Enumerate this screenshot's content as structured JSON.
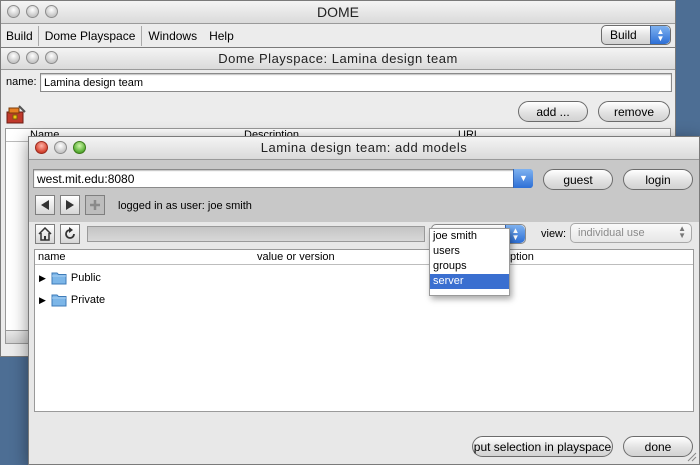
{
  "dome_window": {
    "title": "DOME"
  },
  "menubar": {
    "items": [
      "Build",
      "Dome Playspace",
      "Windows",
      "Help"
    ],
    "mode_select": "Build"
  },
  "playspace_window": {
    "title": "Dome Playspace: Lamina design team",
    "name_label": "name:",
    "name_value": "Lamina design team",
    "add_label": "add ...",
    "remove_label": "remove",
    "columns": [
      "Name",
      "Description",
      "URL"
    ]
  },
  "add_models_window": {
    "title": "Lamina design team: add models",
    "server_value": "west.mit.edu:8080",
    "guest_label": "guest",
    "login_label": "login",
    "status_text": "logged in as user: joe smith",
    "view_label": "view:",
    "view_value": "individual use",
    "columns": [
      "name",
      "value or version",
      "ption"
    ],
    "folders": [
      "Public",
      "Private"
    ],
    "dropdown": {
      "options": [
        "joe smith",
        "users",
        "groups",
        "server"
      ],
      "highlighted": "server"
    },
    "put_selection_label": "put selection in playspace",
    "done_label": "done"
  },
  "colors": {
    "desktop": "#4d6e94",
    "highlight": "#3a6fd0",
    "folder": "#7cb6e8"
  },
  "icons": [
    "tools-icon",
    "back-arrow-icon",
    "forward-arrow-icon",
    "plus-icon",
    "home-icon",
    "refresh-icon",
    "folder-icon",
    "disclosure-triangle-icon"
  ]
}
